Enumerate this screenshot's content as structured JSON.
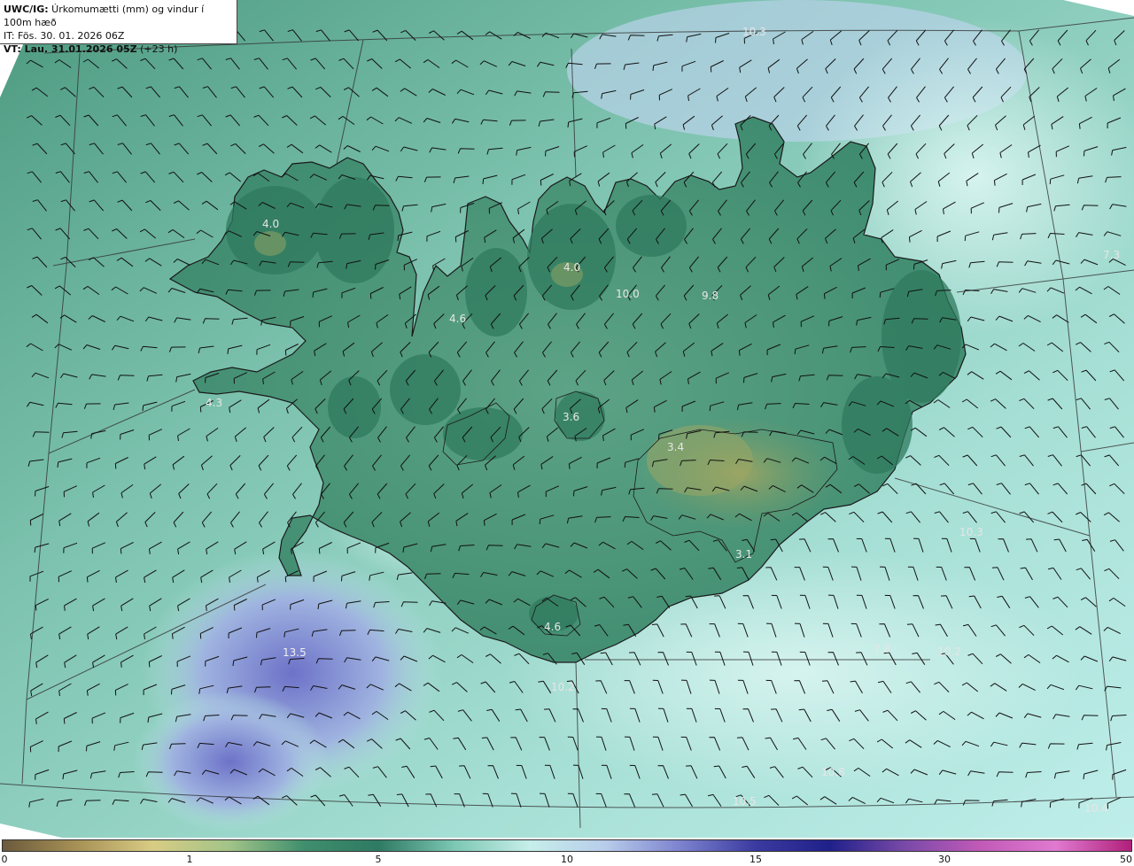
{
  "header": {
    "title_bold": "UWC/IG:",
    "title_rest": " Úrkomumætti (mm) og vindur í 100m hæð",
    "init_time": "IT: Fös. 30. 01. 2026 06Z",
    "valid_bold": "VT: Lau. 31.01.2026 05Z",
    "valid_rest": " (+23 h)"
  },
  "colorbar": {
    "ticks": [
      "0",
      "1",
      "5",
      "10",
      "15",
      "30",
      "50"
    ],
    "colors": [
      "#6b5a3c",
      "#a89256",
      "#d8cc84",
      "#a3c488",
      "#3f8f6e",
      "#2f7a63",
      "#7cc7b3",
      "#c6eeea",
      "#b8cdea",
      "#7d83cf",
      "#3a3aa0",
      "#20208a",
      "#7a4aa8",
      "#c25ab8",
      "#e07ad0",
      "#b0207a"
    ]
  },
  "map_labels": [
    "4.0",
    "4.0",
    "10.0",
    "9.8",
    "4.6",
    "4.3",
    "3.6",
    "3.4",
    "3.1",
    "4.6",
    "13.5",
    "10.2",
    "7.8",
    "10.2",
    "10.3",
    "7.3",
    "10.8",
    "10.5",
    "10.4",
    "10.3"
  ],
  "colors": {
    "land_dark": "#2e7a5e",
    "land_mid": "#4f9a80",
    "sea_light": "#a8e0d6",
    "sea_pale": "#cdf1ec",
    "precip_blue": "#7f8fd6",
    "highland_olive": "#8a9a5a",
    "coast": "#1a1a1a"
  }
}
